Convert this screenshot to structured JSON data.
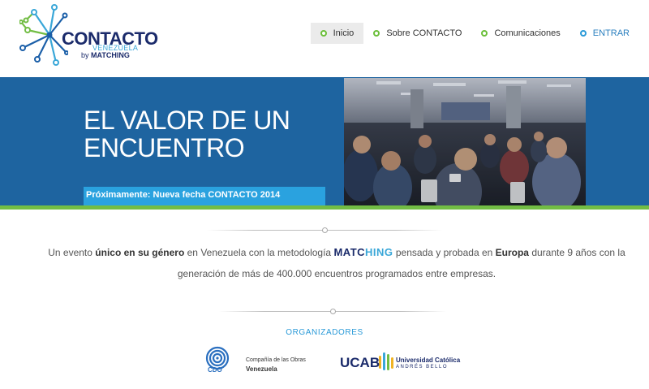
{
  "header": {
    "logo": {
      "title": "CONTACTO",
      "subtitle": "VENEZUELA",
      "by_prefix": "by",
      "by_brand": "MATCHING"
    },
    "nav": [
      {
        "label": "Inicio",
        "active": true
      },
      {
        "label": "Sobre CONTACTO",
        "active": false
      },
      {
        "label": "Comunicaciones",
        "active": false
      },
      {
        "label": "ENTRAR",
        "active": false
      }
    ]
  },
  "hero": {
    "title_line1": "EL VALOR DE UN",
    "title_line2": "ENCUENTRO",
    "announcement": "Próximamente: Nueva fecha CONTACTO 2014",
    "colors": {
      "background": "#1e64a0",
      "bar": "#2aa2df",
      "stripe": "#72bd44"
    }
  },
  "intro": {
    "part1": "Un evento ",
    "bold1": "único en su género",
    "part2": " en Venezuela con la metodología ",
    "brand_a": "MATC",
    "brand_b": "HING",
    "part3": " pensada y probada en ",
    "bold2": "Europa",
    "part4": " durante 9 años con la generación de más de 400.000 encuentros programados entre empresas."
  },
  "organizers": {
    "heading": "ORGANIZADORES",
    "cdo": {
      "abbr": "CDO",
      "line1": "Compañía de las Obras",
      "line2": "Venezuela"
    },
    "ucab": {
      "abbr": "UCAB",
      "line1": "Universidad Católica",
      "line2": "ANDRÉS BELLO"
    }
  }
}
